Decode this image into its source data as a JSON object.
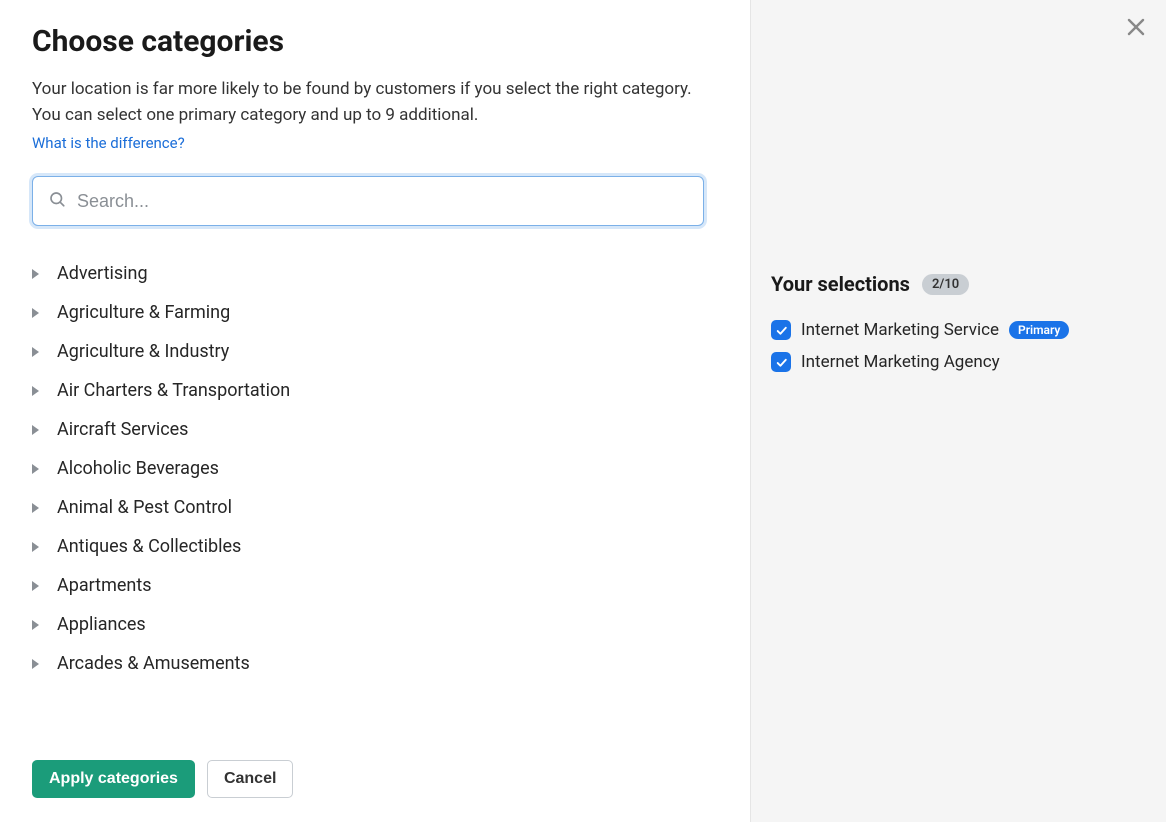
{
  "header": {
    "title": "Choose categories",
    "subtitle": "Your location is far more likely to be found by customers if you select the right category. You can select one primary category and up to 9 additional.",
    "diff_link": "What is the difference?"
  },
  "search": {
    "placeholder": "Search..."
  },
  "categories": [
    "Advertising",
    "Agriculture & Farming",
    "Agriculture & Industry",
    "Air Charters & Transportation",
    "Aircraft Services",
    "Alcoholic Beverages",
    "Animal & Pest Control",
    "Antiques & Collectibles",
    "Apartments",
    "Appliances",
    "Arcades & Amusements"
  ],
  "actions": {
    "apply": "Apply categories",
    "cancel": "Cancel"
  },
  "selections": {
    "title": "Your selections",
    "count": "2/10",
    "items": [
      {
        "label": "Internet Marketing Service",
        "primary": true
      },
      {
        "label": "Internet Marketing Agency",
        "primary": false
      }
    ],
    "primary_badge": "Primary"
  }
}
